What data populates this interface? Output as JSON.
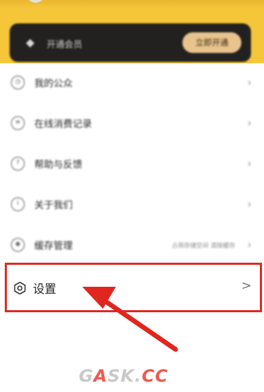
{
  "header": {
    "vip_label": "开通会员",
    "vip_button": "立即开通"
  },
  "menu": [
    {
      "label": "我的公众",
      "icon": "clock-icon",
      "sub": ""
    },
    {
      "label": "在线消费记录",
      "icon": "receipt-icon",
      "sub": ""
    },
    {
      "label": "帮助与反馈",
      "icon": "help-icon",
      "sub": ""
    },
    {
      "label": "关于我们",
      "icon": "info-icon",
      "sub": ""
    },
    {
      "label": "缓存管理",
      "icon": "eye-icon",
      "sub": "占用存储空间 清除缓存"
    }
  ],
  "settings": {
    "label": "设置",
    "icon": "hexagon-gear-icon",
    "chevron": ">"
  },
  "annotation": {
    "box_color": "#e0261f",
    "arrow_color": "#e0261f"
  },
  "watermark": {
    "part1": "G",
    "accent1": "A",
    "part2": "SK.",
    "accent2": "CC"
  }
}
